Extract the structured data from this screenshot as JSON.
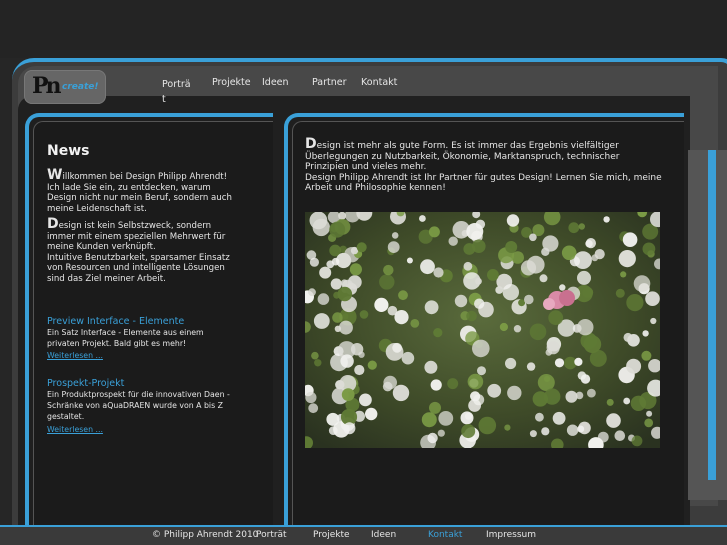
{
  "logo": {
    "mark": "Pn",
    "word": "create!"
  },
  "nav": {
    "items": [
      {
        "label": "Porträ\nt"
      },
      {
        "label": "Projekte"
      },
      {
        "label": "Ideen"
      },
      {
        "label": "Partner"
      },
      {
        "label": "Kontakt"
      }
    ]
  },
  "sidebar": {
    "title": "News",
    "intro": {
      "p1_dropcap": "W",
      "p1_rest": "illkommen bei Design Philipp Ahrendt! Ich lade Sie ein, zu entdecken, warum Design nicht nur mein Beruf, sondern auch meine Leidenschaft ist.",
      "p2_dropcap": "D",
      "p2_rest": "esign ist kein Selbstzweck, sondern immer mit einem speziellen Mehrwert für meine Kunden verknüpft.",
      "p2_more": "Intuitive Benutzbarkeit, sparsamer Einsatz von Resourcen und intelligente Lösungen sind das Ziel meiner Arbeit."
    },
    "posts": [
      {
        "title": "Preview Interface - Elemente",
        "body": "Ein Satz Interface - Elemente aus einem privaten Projekt. Bald gibt es mehr!",
        "more": "Weiterlesen ..."
      },
      {
        "title": "Prospekt-Projekt",
        "body": "Ein Produktprospekt für die innovativen Daen - Schränke von aQuaDRAEN wurde von A bis Z gestaltet.",
        "more": "Weiterlesen ..."
      }
    ]
  },
  "main": {
    "dropcap": "D",
    "text1": "esign ist mehr als gute Form. Es ist immer das Ergebnis vielfältiger Überlegungen zu Nutzbarkeit, Ökonomie, Marktanspruch, technischer Prinzipien und vieles mehr.",
    "text2": "Design Philipp Ahrendt ist Ihr Partner für gutes Design! Lernen Sie mich, meine Arbeit und Philosophie kennen!"
  },
  "footer": {
    "copyright": "© Philipp Ahrendt 2010",
    "links": [
      {
        "label": "Porträt"
      },
      {
        "label": "Projekte"
      },
      {
        "label": "Ideen"
      },
      {
        "label": "Kontakt"
      },
      {
        "label": "Impressum"
      }
    ]
  },
  "colors": {
    "accent": "#3aa0d8",
    "background": "#262626"
  }
}
